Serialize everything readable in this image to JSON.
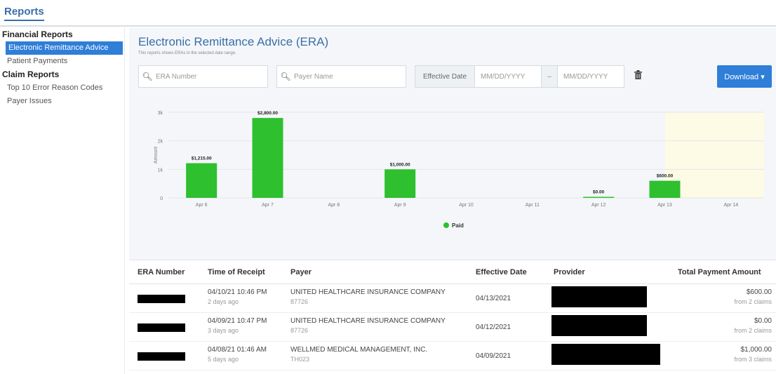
{
  "app": {
    "title": "Reports"
  },
  "sidebar": {
    "financial_heading": "Financial Reports",
    "financial_items": [
      {
        "label": "Electronic Remittance Advice"
      },
      {
        "label": "Patient Payments"
      }
    ],
    "claim_heading": "Claim Reports",
    "claim_items": [
      {
        "label": "Top 10 Error Reason Codes"
      },
      {
        "label": "Payer Issues"
      }
    ]
  },
  "main": {
    "title": "Electronic Remittance Advice (ERA)",
    "subtitle": "This reports shows ERAs in the selected date range."
  },
  "filters": {
    "era_placeholder": "ERA Number",
    "payer_placeholder": "Payer Name",
    "effective_date_label": "Effective Date",
    "date_from_placeholder": "MM/DD/YYYY",
    "date_sep": "–",
    "date_to_placeholder": "MM/DD/YYYY",
    "download_label": "Download ▾"
  },
  "chart_data": {
    "type": "bar",
    "categories": [
      "Apr 6",
      "Apr 7",
      "Apr 8",
      "Apr 9",
      "Apr 10",
      "Apr 11",
      "Apr 12",
      "Apr 13",
      "Apr 14"
    ],
    "series": [
      {
        "name": "Paid",
        "values": [
          1215,
          2800,
          null,
          1000,
          null,
          null,
          0,
          600,
          null
        ]
      }
    ],
    "data_labels": [
      "$1,215.00",
      "$2,800.00",
      "",
      "$1,000.00",
      "",
      "",
      "$0.00",
      "$600.00",
      ""
    ],
    "ylabel": "Amount",
    "yticks": [
      "0",
      "1k",
      "2k",
      "3k"
    ],
    "ylim": [
      0,
      3000
    ],
    "color": "#2ec02e",
    "highlight_region_after": "Apr 13",
    "highlight_color": "#fdfbe6",
    "legend": "bottom",
    "grid": true
  },
  "table": {
    "headers": [
      "ERA Number",
      "Time of Receipt",
      "Payer",
      "Effective Date",
      "Provider",
      "Total Payment Amount"
    ],
    "rows": [
      {
        "time": "04/10/21 10:46 PM",
        "ago": "2 days ago",
        "payer": "UNITED HEALTHCARE INSURANCE COMPANY",
        "payer_id": "87726",
        "effective": "04/13/2021",
        "amount": "$600.00",
        "claims": "from 2 claims"
      },
      {
        "time": "04/09/21 10:47 PM",
        "ago": "3 days ago",
        "payer": "UNITED HEALTHCARE INSURANCE COMPANY",
        "payer_id": "87726",
        "effective": "04/12/2021",
        "amount": "$0.00",
        "claims": "from 2 claims"
      },
      {
        "time": "04/08/21 01:46 AM",
        "ago": "5 days ago",
        "payer": "WELLMED MEDICAL MANAGEMENT, INC.",
        "payer_id": "TH023",
        "effective": "04/09/2021",
        "amount": "$1,000.00",
        "claims": "from 3 claims"
      }
    ]
  }
}
